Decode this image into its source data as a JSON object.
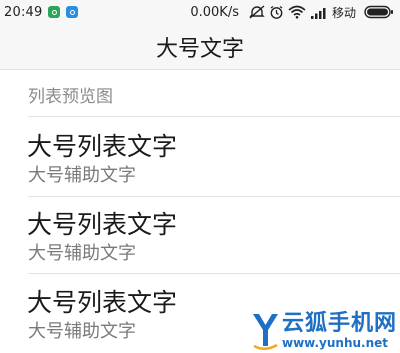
{
  "status_bar": {
    "time": "20:49",
    "net_speed": "0.00K/s",
    "carrier": "移动",
    "icons": [
      "app-icon-green",
      "app-icon-blue",
      "mute-icon",
      "alarm-icon",
      "wifi-icon",
      "signal-icon",
      "battery-icon"
    ]
  },
  "header": {
    "title": "大号文字"
  },
  "list": {
    "section_header": "列表预览图",
    "items": [
      {
        "primary": "大号列表文字",
        "secondary": "大号辅助文字"
      },
      {
        "primary": "大号列表文字",
        "secondary": "大号辅助文字"
      },
      {
        "primary": "大号列表文字",
        "secondary": "大号辅助文字"
      }
    ]
  },
  "watermark": {
    "name": "云狐手机网",
    "url": "www.yunhu.net"
  },
  "colors": {
    "accent": "#1f6fc4",
    "primary_text": "#1a1a1a",
    "secondary_text": "#7a7a7a",
    "divider": "#e3e3e3"
  }
}
